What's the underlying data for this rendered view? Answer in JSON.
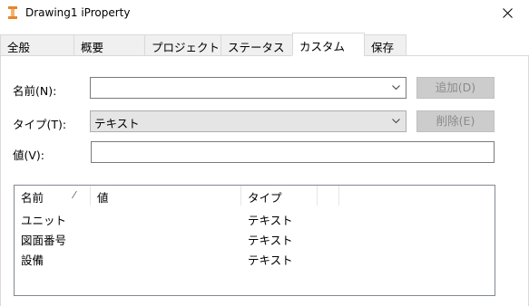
{
  "window": {
    "title": "Drawing1 iProperty",
    "app_icon": "inventor-icon",
    "close_icon": "close-icon"
  },
  "tabs": [
    {
      "label": "全般"
    },
    {
      "label": "概要"
    },
    {
      "label": "プロジェクト"
    },
    {
      "label": "ステータス"
    },
    {
      "label": "カスタム",
      "active": true
    },
    {
      "label": "保存"
    }
  ],
  "form": {
    "name_label": "名前(N):",
    "name_value": "",
    "type_label": "タイプ(T):",
    "type_value": "テキスト",
    "value_label": "値(V):",
    "value_value": "",
    "add_button": "追加(D)",
    "delete_button": "削除(E)"
  },
  "table": {
    "columns": [
      "名前",
      "値",
      "タイプ",
      ""
    ],
    "sort_indicator": "⁄",
    "rows": [
      {
        "name": "ユニット",
        "value": "",
        "type": "テキスト"
      },
      {
        "name": "図面番号",
        "value": "",
        "type": "テキスト"
      },
      {
        "name": "設備",
        "value": "",
        "type": "テキスト"
      }
    ]
  },
  "colors": {
    "disabled_button_bg": "#cccccc",
    "combo_gray_bg": "#e5e5e5",
    "app_icon": "#e8852a"
  }
}
